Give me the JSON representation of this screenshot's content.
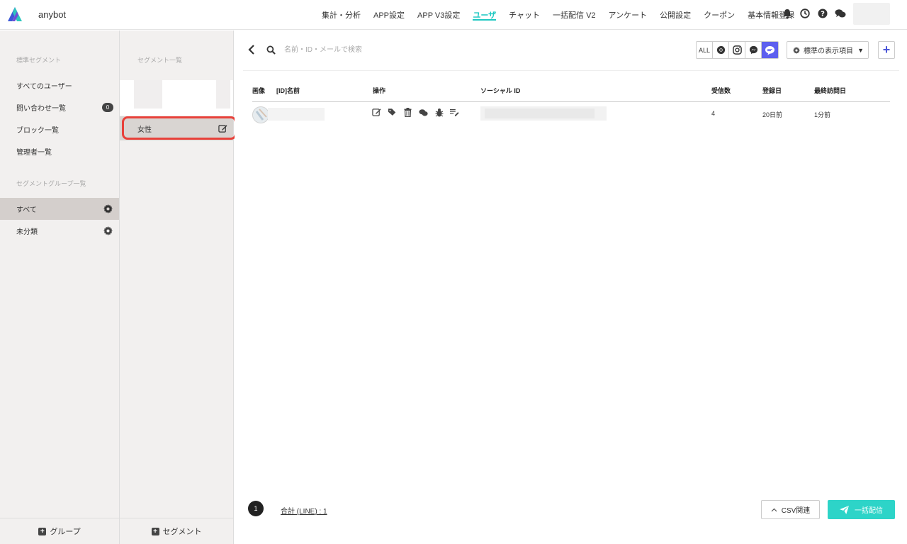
{
  "app": {
    "name": "anybot",
    "accent_color": "#1ec8c1"
  },
  "nav": {
    "items": [
      "集計・分析",
      "APP設定",
      "APP V3設定",
      "ユーザ",
      "チャット",
      "一括配信 V2",
      "アンケート",
      "公開設定",
      "クーポン",
      "基本情報登録"
    ],
    "active": "ユーザ",
    "icons": [
      "bell-icon",
      "clock-icon",
      "help-icon",
      "chat-icon"
    ]
  },
  "sidebar": {
    "standard_heading": "標準セグメント",
    "standard_items": [
      {
        "label": "すべてのユーザー"
      },
      {
        "label": "問い合わせ一覧",
        "badge": "0"
      },
      {
        "label": "ブロック一覧"
      },
      {
        "label": "管理者一覧"
      }
    ],
    "group_heading": "セグメントグループ一覧",
    "group_items": [
      {
        "label": "すべて",
        "selected": true
      },
      {
        "label": "未分類",
        "selected": false
      }
    ],
    "footer_label": "グループ"
  },
  "segments": {
    "heading": "セグメント一覧",
    "items": [
      {
        "label": "女性",
        "highlighted": true
      }
    ],
    "footer_label": "セグメント"
  },
  "toolbar": {
    "search_placeholder": "名前・ID・メールで検索",
    "channels": [
      "ALL",
      "chrome",
      "instagram",
      "messenger",
      "line"
    ],
    "active_channel": "line",
    "display_select_label": "標準の表示項目",
    "add_label": "+"
  },
  "table": {
    "headers": [
      "画像",
      "[ID]名前",
      "操作",
      "ソーシャル ID",
      "受信数",
      "登録日",
      "最終訪問日"
    ],
    "rows": [
      {
        "received": "4",
        "registered": "20日前",
        "last_visit": "1分前"
      }
    ]
  },
  "footer": {
    "page": "1",
    "total_label": "合計 (LINE) : 1",
    "csv_label": "CSV関連",
    "bulk_label": "一括配信"
  }
}
